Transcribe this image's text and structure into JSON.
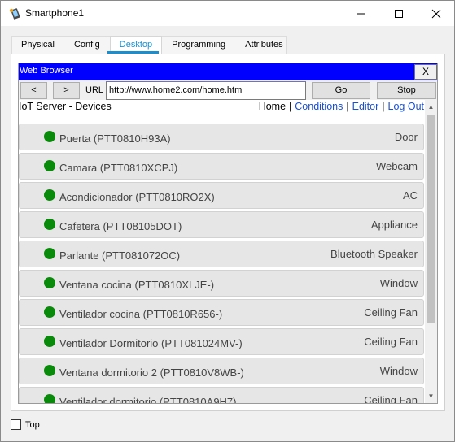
{
  "window": {
    "title": "Smartphone1",
    "icon": "phone-icon"
  },
  "tabs": [
    {
      "label": "Physical",
      "active": false
    },
    {
      "label": "Config",
      "active": false
    },
    {
      "label": "Desktop",
      "active": true
    },
    {
      "label": "Programming",
      "active": false
    },
    {
      "label": "Attributes",
      "active": false
    }
  ],
  "browser": {
    "title": "Web Browser",
    "close_label": "X",
    "back_label": "<",
    "forward_label": ">",
    "url_label": "URL",
    "url_value": "http://www.home2.com/home.html",
    "go_label": "Go",
    "stop_label": "Stop"
  },
  "page": {
    "title": "IoT Server - Devices",
    "links": {
      "home": "Home",
      "conditions": "Conditions",
      "editor": "Editor",
      "logout": "Log Out"
    },
    "devices": [
      {
        "name": "Puerta (PTT0810H93A)",
        "type": "Door",
        "status_color": "#0a8a0a"
      },
      {
        "name": "Camara (PTT0810XCPJ)",
        "type": "Webcam",
        "status_color": "#0a8a0a"
      },
      {
        "name": "Acondicionador (PTT0810RO2X)",
        "type": "AC",
        "status_color": "#0a8a0a"
      },
      {
        "name": "Cafetera (PTT08105DOT)",
        "type": "Appliance",
        "status_color": "#0a8a0a"
      },
      {
        "name": "Parlante (PTT081072OC)",
        "type": "Bluetooth Speaker",
        "status_color": "#0a8a0a"
      },
      {
        "name": "Ventana cocina (PTT0810XLJE-)",
        "type": "Window",
        "status_color": "#0a8a0a"
      },
      {
        "name": "Ventilador cocina (PTT0810R656-)",
        "type": "Ceiling Fan",
        "status_color": "#0a8a0a"
      },
      {
        "name": "Ventilador Dormitorio (PTT081024MV-)",
        "type": "Ceiling Fan",
        "status_color": "#0a8a0a"
      },
      {
        "name": "Ventana dormitorio 2 (PTT0810V8WB-)",
        "type": "Window",
        "status_color": "#0a8a0a"
      },
      {
        "name": "Ventilador dormitorio (PTT0810A9H7)",
        "type": "Ceiling Fan",
        "status_color": "#0a8a0a"
      }
    ]
  },
  "footer": {
    "top_label": "Top",
    "top_checked": false
  },
  "colors": {
    "browser_titlebar": "#0000ff",
    "tab_active": "#1a8fd0",
    "link": "#1a4fd0",
    "status_online": "#0a8a0a"
  }
}
